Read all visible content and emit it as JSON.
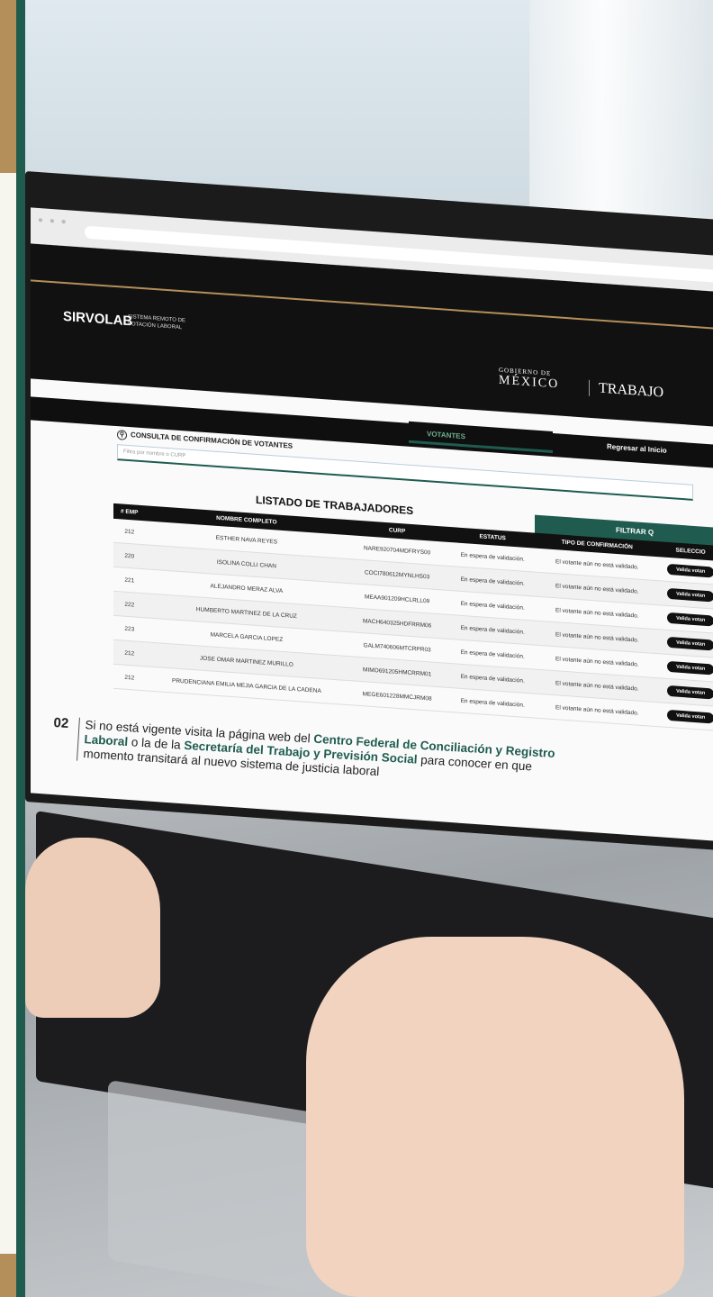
{
  "site": {
    "logo": "SIRVOLAB",
    "logo_subtitle": "SISTEMA REMOTO DE VOTACIÓN LABORAL",
    "gob_small": "GOBIERNO DE",
    "gob_big": "MÉXICO",
    "trabajo": "TRABAJO"
  },
  "nav": {
    "votantes": "VOTANTES",
    "regresar": "Regresar al Inicio"
  },
  "consulta": {
    "title": "CONSULTA DE CONFIRMACIÓN DE VOTANTES",
    "placeholder": "Filtra por nombre o CURP"
  },
  "listado": {
    "title": "LISTADO DE TRABAJADORES",
    "filtrar": "FILTRAR Q"
  },
  "table": {
    "headers": [
      "# EMP",
      "NOMBRE COMPLETO",
      "CURP",
      "ESTATUS",
      "TIPO DE CONFIRMACIÓN",
      "SELECCIO"
    ],
    "rows": [
      {
        "emp": "212",
        "name": "ESTHER NAVA REYES",
        "curp": "NARE920704MDFRYS00",
        "status": "En espera de validación.",
        "tipo": "El votante aún no está validado.",
        "btn": "Valida votan"
      },
      {
        "emp": "220",
        "name": "ISOLINA COLLI CHAN",
        "curp": "COCI780612MYNLHS03",
        "status": "En espera de validación.",
        "tipo": "El votante aún no está validado.",
        "btn": "Valida votan"
      },
      {
        "emp": "221",
        "name": "ALEJANDRO MERAZ ALVA",
        "curp": "MEAA901209HCLRLL09",
        "status": "En espera de validación.",
        "tipo": "El votante aún no está validado.",
        "btn": "Valida votan"
      },
      {
        "emp": "222",
        "name": "HUMBERTO MARTINEZ DE LA CRUZ",
        "curp": "MACH640325HDFRRM06",
        "status": "En espera de validación.",
        "tipo": "El votante aún no está validado.",
        "btn": "Valida votan"
      },
      {
        "emp": "223",
        "name": "MARCELA GARCIA LOPEZ",
        "curp": "GALM740606MTCRPR03",
        "status": "En espera de validación.",
        "tipo": "El votante aún no está validado.",
        "btn": "Valida votan"
      },
      {
        "emp": "212",
        "name": "JOSE OMAR MARTINEZ MURILLO",
        "curp": "MIMO691205HMCRRM01",
        "status": "En espera de validación.",
        "tipo": "El votante aún no está validado.",
        "btn": "Valida votan"
      },
      {
        "emp": "212",
        "name": "PRUDENCIANA EMILIA MEJIA GARCIA DE LA CADENA",
        "curp": "MEGE601228MMCJRM08",
        "status": "En espera de validación.",
        "tipo": "El votante aún no está validado.",
        "btn": "Valida votan"
      }
    ]
  },
  "caption": {
    "number": "02",
    "part1": "Si no está vigente visita la página web del ",
    "bold1": "Centro Federal de Conciliación y Registro Laboral",
    "part2": " o la de la ",
    "bold2": "Secretaría del Trabajo y Previsión Social",
    "part3": " para conocer en que momento transitará al nuevo sistema de justicia laboral"
  },
  "colors": {
    "green": "#1f5c4f",
    "gold": "#b48f5a",
    "dark": "#111111"
  }
}
